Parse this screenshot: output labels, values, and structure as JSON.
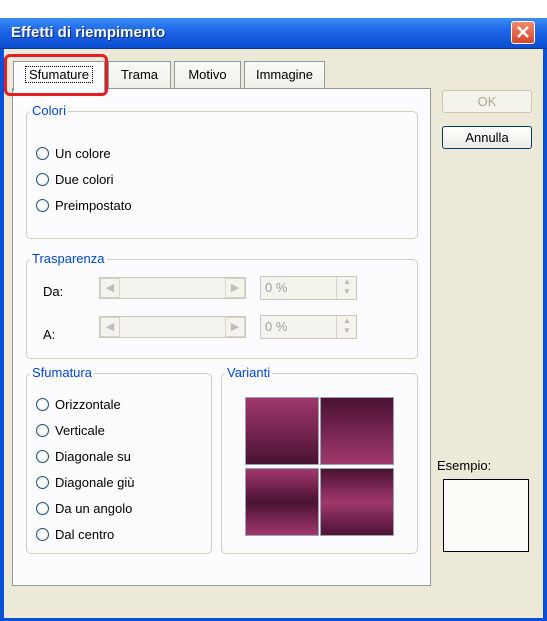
{
  "window": {
    "title": "Effetti di riempimento"
  },
  "tabs": [
    "Sfumature",
    "Trama",
    "Motivo",
    "Immagine"
  ],
  "buttons": {
    "ok": "OK",
    "cancel": "Annulla"
  },
  "colori": {
    "title": "Colori",
    "options": [
      "Un colore",
      "Due colori",
      "Preimpostato"
    ]
  },
  "trasparenza": {
    "title": "Trasparenza",
    "da_label": "Da:",
    "da_value": "0 %",
    "a_label": "A:",
    "a_value": "0 %"
  },
  "sfumatura": {
    "title": "Sfumatura",
    "options": [
      "Orizzontale",
      "Verticale",
      "Diagonale su",
      "Diagonale giù",
      "Da un angolo",
      "Dal centro"
    ]
  },
  "varianti": {
    "title": "Varianti"
  },
  "esempio": {
    "label": "Esempio:"
  },
  "colors": {
    "accent": "#0046d5",
    "highlight": "#e31f25",
    "gradient_dark": "#4a1232",
    "gradient_light": "#a0386c"
  }
}
